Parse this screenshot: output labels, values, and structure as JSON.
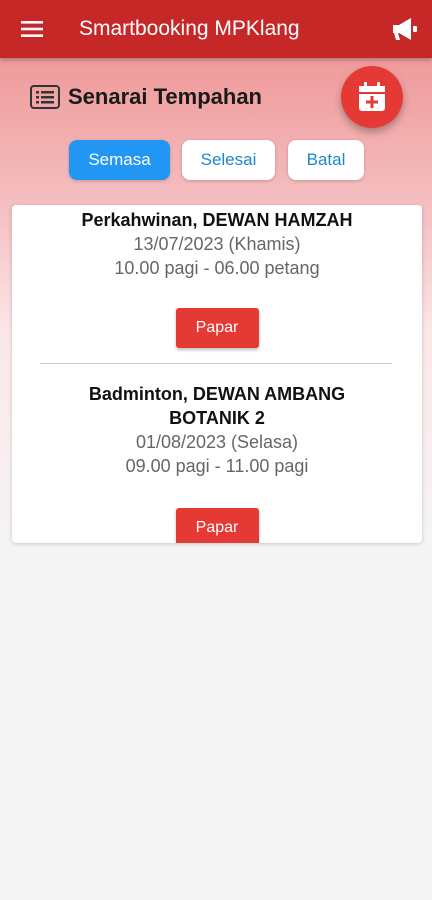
{
  "appbar": {
    "title": "Smartbooking MPKlang",
    "menu_icon": "hamburger-menu-icon",
    "announce_icon": "megaphone-icon",
    "color": "#c62828"
  },
  "page": {
    "title": "Senarai Tempahan",
    "list_icon": "list-icon",
    "fab_icon": "calendar-add-icon",
    "accent": "#e53935"
  },
  "tabs": [
    {
      "label": "Semasa",
      "active": true
    },
    {
      "label": "Selesai",
      "active": false
    },
    {
      "label": "Batal",
      "active": false
    }
  ],
  "bookings": [
    {
      "title": "Perkahwinan, DEWAN HAMZAH",
      "date": "13/07/2023 (Khamis)",
      "time": "10.00 pagi - 06.00 petang",
      "button": "Papar"
    },
    {
      "title": "Badminton, DEWAN AMBANG BOTANIK 2",
      "date": "01/08/2023 (Selasa)",
      "time": "09.00 pagi - 11.00 pagi",
      "button": "Papar"
    }
  ]
}
